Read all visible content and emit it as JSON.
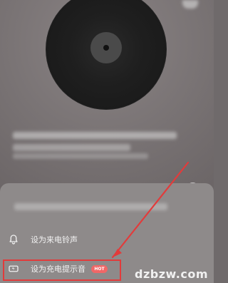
{
  "sheet": {
    "options": [
      {
        "label": "设为来电铃声",
        "icon": "bell-icon"
      },
      {
        "label": "设为充电提示音",
        "badge": "HOT",
        "icon": "charging-icon"
      }
    ]
  },
  "watermark": "dzbzw.com",
  "colors": {
    "highlight": "#e23b3b",
    "badge": "#f06767"
  }
}
